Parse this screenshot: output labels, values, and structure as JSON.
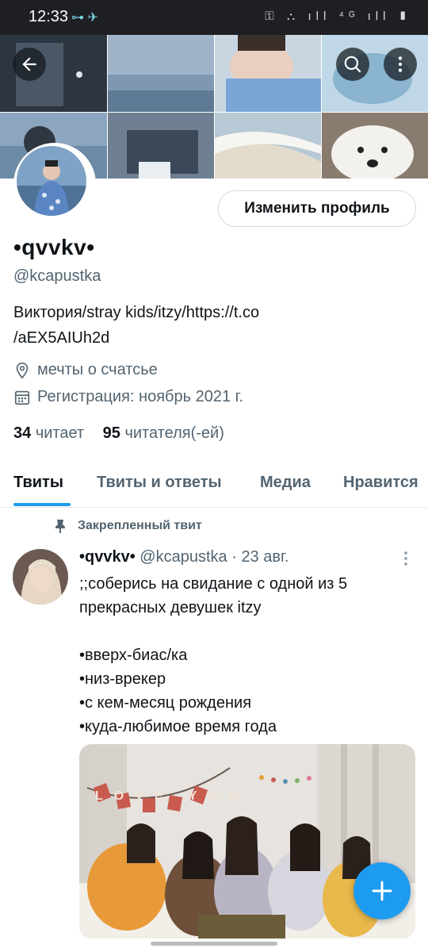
{
  "status_bar": {
    "time": "12:33",
    "left_icons": "⊶ ✈",
    "right_icons": "⚿ ⛬ ıll ⁴ᴳ ıll ▮"
  },
  "header": {
    "back_icon": "arrow-left-icon",
    "search_icon": "search-icon",
    "more_icon": "more-vertical-icon"
  },
  "profile": {
    "edit_button": "Изменить профиль",
    "display_name": "•qvvkv•",
    "handle": "@kcapustka",
    "bio_line1": "Виктория/stray kids/itzy/https://t.co",
    "bio_line2": "/aEX5AIUh2d",
    "location": "мечты о счатсье",
    "joined": "Регистрация: ноябрь 2021 г.",
    "following_count": "34",
    "following_label": "читает",
    "followers_count": "95",
    "followers_label": "читателя(-ей)"
  },
  "tabs": [
    {
      "label": "Твиты",
      "active": true
    },
    {
      "label": "Твиты и ответы",
      "active": false
    },
    {
      "label": "Медиа",
      "active": false
    },
    {
      "label": "Нравится",
      "active": false
    }
  ],
  "pinned_tweet": {
    "pinned_label": "Закрепленный твит",
    "author_name": "•qvvkv•",
    "author_handle": "@kcapustka",
    "separator": "·",
    "date": "23 авг.",
    "text": ";;соберись на свидание с одной из 5 прекрасных девушек itzy\n\n•вверх-биас/ка\n•низ-врекер\n•с кем-месяц рождения\n•куда-любимое время года",
    "media_banner_text": "LOVE YOU"
  },
  "fab": {
    "icon": "plus-icon"
  },
  "colors": {
    "accent": "#1d9bf0",
    "text": "#0f1419",
    "secondary": "#536471"
  }
}
